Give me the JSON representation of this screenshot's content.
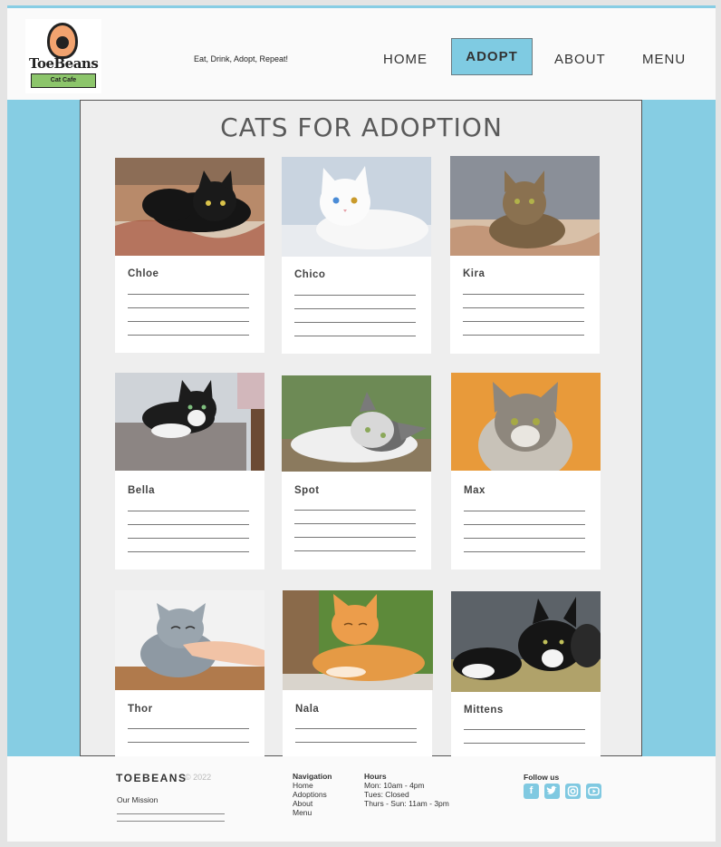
{
  "header": {
    "logo_text": "ToeBeans",
    "logo_subtext": "Cat Cafe",
    "tagline": "Eat, Drink, Adopt, Repeat!",
    "nav": [
      {
        "label": "HOME"
      },
      {
        "label": "ADOPT",
        "active": true
      },
      {
        "label": "ABOUT"
      },
      {
        "label": "MENU"
      }
    ]
  },
  "main": {
    "title": "CATS FOR ADOPTION",
    "cats": [
      {
        "name": "Chloe",
        "photo": "black-cat-photo"
      },
      {
        "name": "Chico",
        "photo": "white-cat-photo"
      },
      {
        "name": "Kira",
        "photo": "tabby-cat-photo"
      },
      {
        "name": "Bella",
        "photo": "tuxedo-cat-photo"
      },
      {
        "name": "Spot",
        "photo": "grey-white-cat-photo"
      },
      {
        "name": "Max",
        "photo": "maine-coon-photo"
      },
      {
        "name": "Thor",
        "photo": "grey-cat-photo"
      },
      {
        "name": "Nala",
        "photo": "orange-cat-photo"
      },
      {
        "name": "Mittens",
        "photo": "kitten-photo"
      }
    ]
  },
  "footer": {
    "brand": "TOEBEANS",
    "copyright": "© 2022",
    "mission_label": "Our Mission",
    "navigation": {
      "heading": "Navigation",
      "links": [
        "Home",
        "Adoptions",
        "About",
        "Menu"
      ]
    },
    "hours": {
      "heading": "Hours",
      "lines": [
        "Mon: 10am - 4pm",
        "Tues: Closed",
        "Thurs - Sun: 11am - 3pm"
      ]
    },
    "follow_label": "Follow us",
    "social_icons": [
      "facebook-icon",
      "twitter-icon",
      "instagram-icon",
      "youtube-icon"
    ]
  },
  "colors": {
    "accent": "#86cde3",
    "panel": "#eeeeee",
    "text": "#333333"
  }
}
